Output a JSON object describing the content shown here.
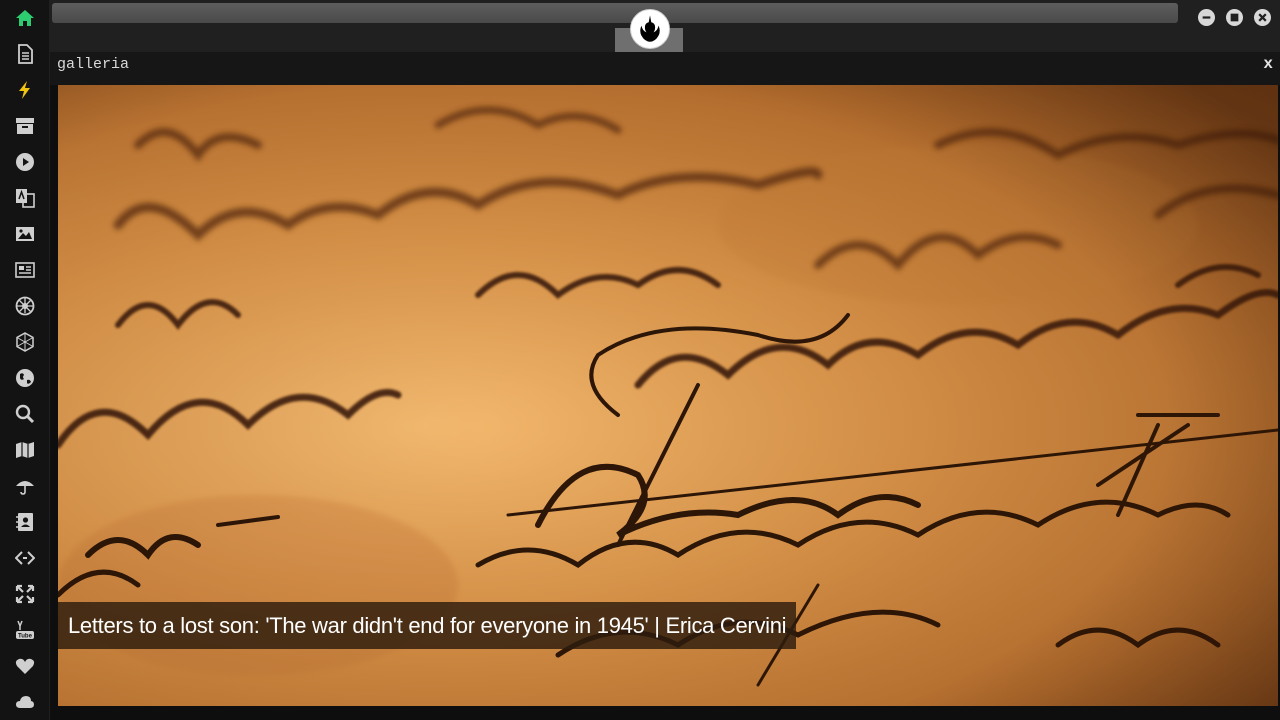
{
  "panel": {
    "title": "galleria",
    "close_label": "x"
  },
  "gallery": {
    "caption": "Letters to a lost son: 'The war didn't end for everyone in 1945' | Erica Cervini"
  },
  "sidebar": {
    "items": [
      {
        "name": "home-icon",
        "active_color": "#2ecc71"
      },
      {
        "name": "document-icon"
      },
      {
        "name": "lightning-icon",
        "active_color": "#f1c40f"
      },
      {
        "name": "archive-icon"
      },
      {
        "name": "play-icon"
      },
      {
        "name": "translate-icon"
      },
      {
        "name": "image-icon"
      },
      {
        "name": "newspaper-icon"
      },
      {
        "name": "empire-icon"
      },
      {
        "name": "hexagon-network-icon"
      },
      {
        "name": "globe-icon"
      },
      {
        "name": "search-icon"
      },
      {
        "name": "map-icon"
      },
      {
        "name": "umbrella-icon"
      },
      {
        "name": "contact-card-icon"
      },
      {
        "name": "code-icon"
      },
      {
        "name": "expand-icon"
      },
      {
        "name": "youtube-icon"
      },
      {
        "name": "heart-icon"
      },
      {
        "name": "cloud-icon"
      }
    ]
  },
  "colors": {
    "accent_green": "#2ecc71",
    "accent_yellow": "#f1c40f",
    "icon_grey": "#cfcfcf"
  }
}
